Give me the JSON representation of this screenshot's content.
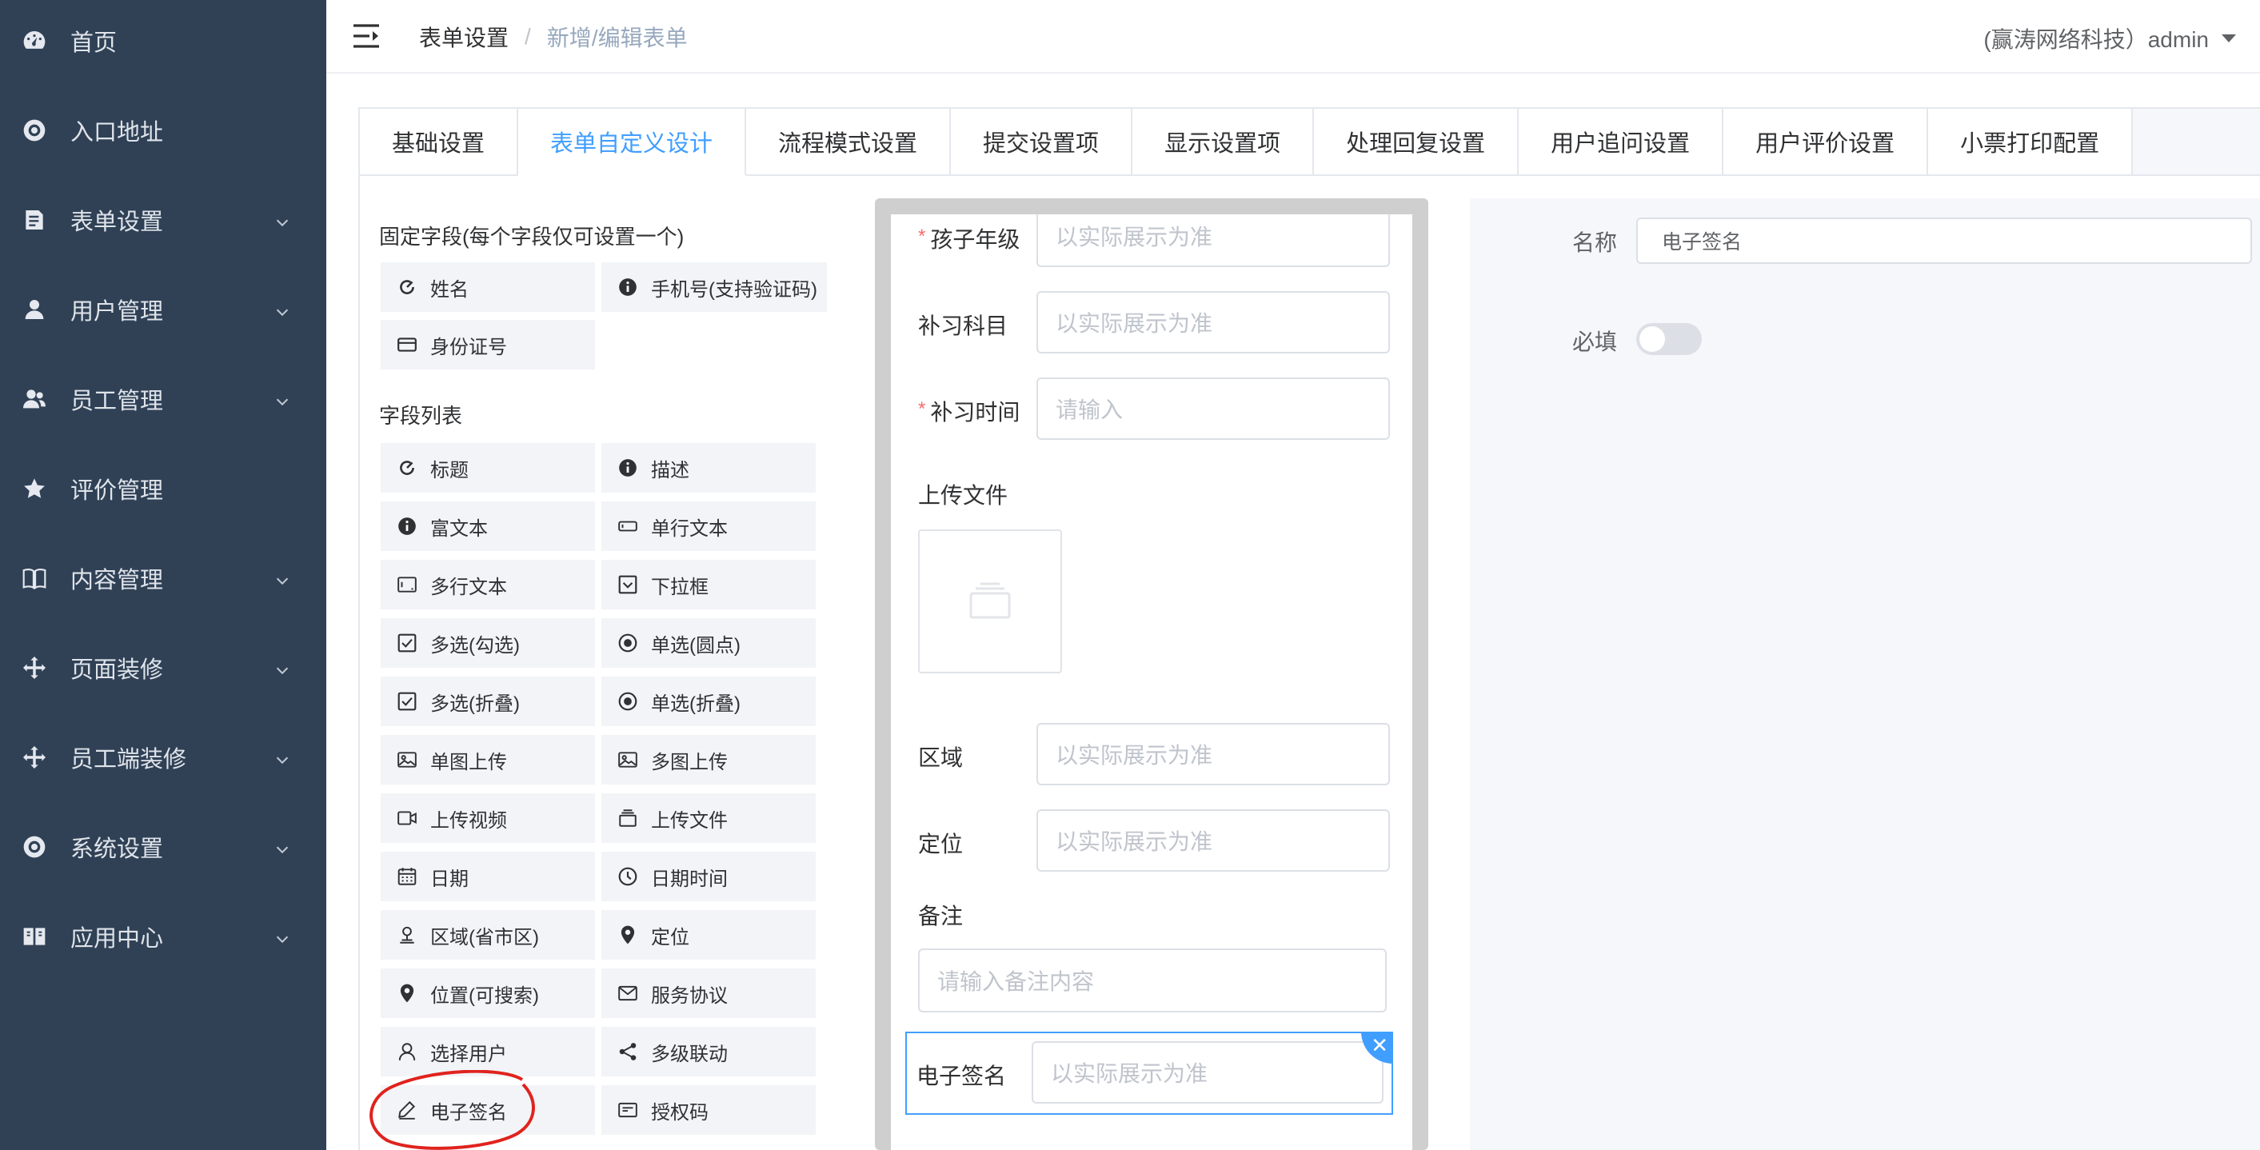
{
  "sidebar": {
    "items": [
      {
        "label": "首页",
        "icon": "dashboard-icon",
        "has_children": false
      },
      {
        "label": "入口地址",
        "icon": "link-icon",
        "has_children": false
      },
      {
        "label": "表单设置",
        "icon": "form-icon",
        "has_children": true
      },
      {
        "label": "用户管理",
        "icon": "user-icon",
        "has_children": true
      },
      {
        "label": "员工管理",
        "icon": "staff-icon",
        "has_children": true
      },
      {
        "label": "评价管理",
        "icon": "star-icon",
        "has_children": false
      },
      {
        "label": "内容管理",
        "icon": "book-icon",
        "has_children": true
      },
      {
        "label": "页面装修",
        "icon": "move-icon",
        "has_children": true
      },
      {
        "label": "员工端装修",
        "icon": "move-icon",
        "has_children": true
      },
      {
        "label": "系统设置",
        "icon": "gear-icon",
        "has_children": true
      },
      {
        "label": "应用中心",
        "icon": "app-icon",
        "has_children": true
      }
    ]
  },
  "header": {
    "breadcrumb": [
      "表单设置",
      "新增/编辑表单"
    ],
    "breadcrumb_separator": "/",
    "user": "(赢涛网络科技）admin"
  },
  "tabs": [
    {
      "label": "基础设置",
      "active": false
    },
    {
      "label": "表单自定义设计",
      "active": true
    },
    {
      "label": "流程模式设置",
      "active": false
    },
    {
      "label": "提交设置项",
      "active": false
    },
    {
      "label": "显示设置项",
      "active": false
    },
    {
      "label": "处理回复设置",
      "active": false
    },
    {
      "label": "用户追问设置",
      "active": false
    },
    {
      "label": "用户评价设置",
      "active": false
    },
    {
      "label": "小票打印配置",
      "active": false
    }
  ],
  "palette": {
    "fixed_title": "固定字段(每个字段仅可设置一个)",
    "fixed_items": [
      {
        "label": "姓名",
        "icon": "refresh-icon"
      },
      {
        "label": "手机号(支持验证码)",
        "icon": "info-icon"
      },
      {
        "label": "身份证号",
        "icon": "card-icon"
      }
    ],
    "list_title": "字段列表",
    "list_items": [
      {
        "label": "标题",
        "icon": "refresh-icon"
      },
      {
        "label": "描述",
        "icon": "info-icon"
      },
      {
        "label": "富文本",
        "icon": "info-icon"
      },
      {
        "label": "单行文本",
        "icon": "input-icon"
      },
      {
        "label": "多行文本",
        "icon": "textarea-icon"
      },
      {
        "label": "下拉框",
        "icon": "dropdown-icon"
      },
      {
        "label": "多选(勾选)",
        "icon": "checkbox-icon"
      },
      {
        "label": "单选(圆点)",
        "icon": "radio-icon"
      },
      {
        "label": "多选(折叠)",
        "icon": "checkbox-icon"
      },
      {
        "label": "单选(折叠)",
        "icon": "radio-icon"
      },
      {
        "label": "单图上传",
        "icon": "image-icon"
      },
      {
        "label": "多图上传",
        "icon": "images-icon"
      },
      {
        "label": "上传视频",
        "icon": "video-icon"
      },
      {
        "label": "上传文件",
        "icon": "file-icon"
      },
      {
        "label": "日期",
        "icon": "calendar-icon"
      },
      {
        "label": "日期时间",
        "icon": "clock-icon"
      },
      {
        "label": "区域(省市区)",
        "icon": "region-icon"
      },
      {
        "label": "定位",
        "icon": "location-icon"
      },
      {
        "label": "位置(可搜索)",
        "icon": "location-icon"
      },
      {
        "label": "服务协议",
        "icon": "mail-icon"
      },
      {
        "label": "选择用户",
        "icon": "user-icon"
      },
      {
        "label": "多级联动",
        "icon": "share-icon"
      },
      {
        "label": "电子签名",
        "icon": "pen-icon"
      },
      {
        "label": "授权码",
        "icon": "code-icon"
      }
    ]
  },
  "preview": {
    "fields": [
      {
        "label": "孩子年级",
        "required": true,
        "placeholder": "以实际展示为准"
      },
      {
        "label": "补习科目",
        "required": false,
        "placeholder": "以实际展示为准"
      },
      {
        "label": "补习时间",
        "required": true,
        "placeholder": "请输入"
      },
      {
        "label": "上传文件",
        "required": false,
        "placeholder": ""
      },
      {
        "label": "区域",
        "required": false,
        "placeholder": "以实际展示为准"
      },
      {
        "label": "定位",
        "required": false,
        "placeholder": "以实际展示为准"
      },
      {
        "label": "备注",
        "required": false,
        "placeholder": "请输入备注内容"
      },
      {
        "label": "电子签名",
        "required": false,
        "placeholder": "以实际展示为准"
      }
    ],
    "required_mark": "*",
    "close_glyph": "✕"
  },
  "properties": {
    "name_label": "名称",
    "name_value": "电子签名",
    "required_label": "必填",
    "required_on": false
  },
  "colors": {
    "sidebar_bg": "#304156",
    "accent": "#409eff",
    "required": "#f56c6c",
    "annotation": "#e0231e"
  }
}
